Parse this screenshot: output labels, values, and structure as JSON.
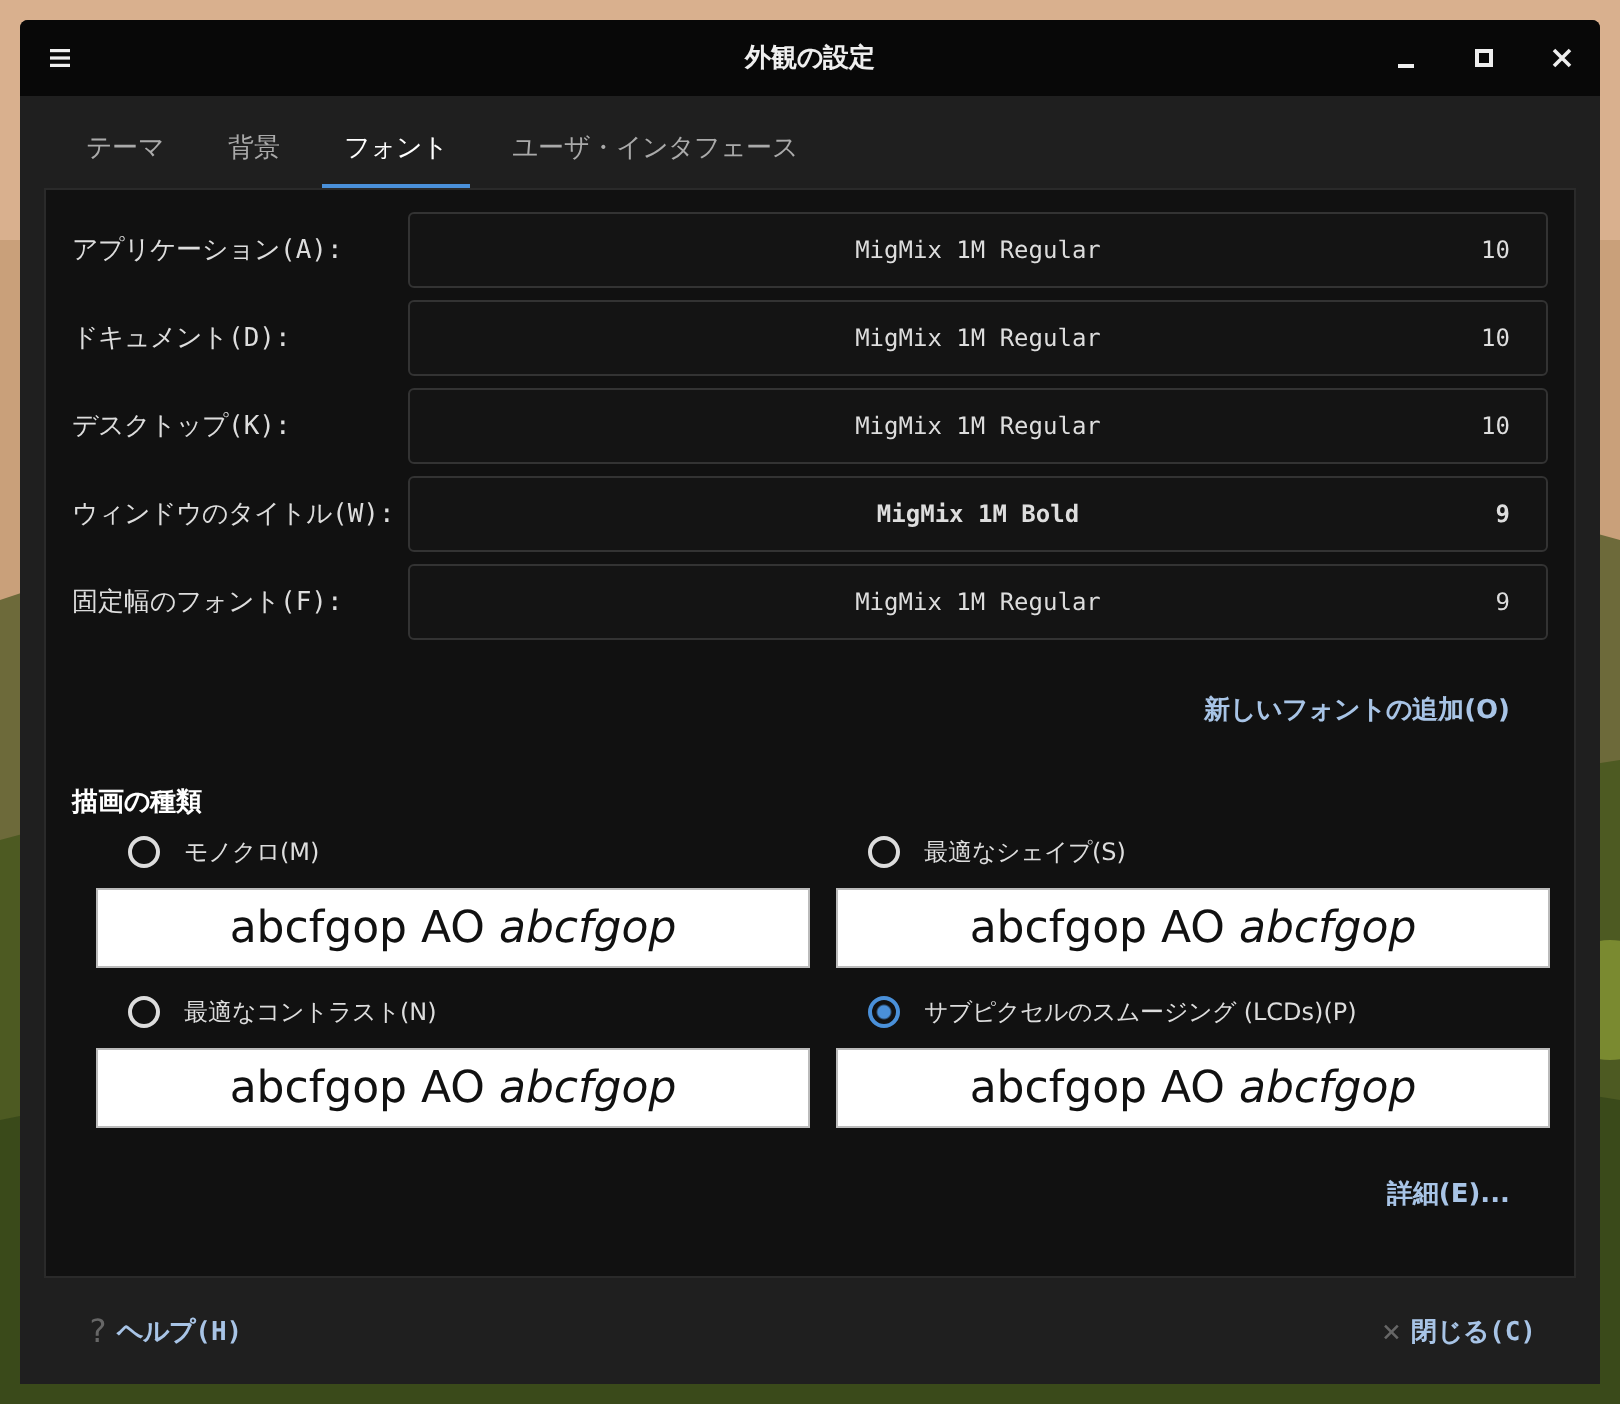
{
  "window": {
    "title": "外観の設定"
  },
  "tabs": [
    {
      "label": "テーマ",
      "selected": false
    },
    {
      "label": "背景",
      "selected": false
    },
    {
      "label": "フォント",
      "selected": true
    },
    {
      "label": "ユーザ・インタフェース",
      "selected": false
    }
  ],
  "fonts": [
    {
      "label": "アプリケーション(A):",
      "font": "MigMix 1M Regular",
      "size": "10",
      "bold": false
    },
    {
      "label": "ドキュメント(D):",
      "font": "MigMix 1M Regular",
      "size": "10",
      "bold": false
    },
    {
      "label": "デスクトップ(K):",
      "font": "MigMix 1M Regular",
      "size": "10",
      "bold": false
    },
    {
      "label": "ウィンドウのタイトル(W):",
      "font": "MigMix 1M Bold",
      "size": "9",
      "bold": true
    },
    {
      "label": "固定幅のフォント(F):",
      "font": "MigMix 1M Regular",
      "size": "9",
      "bold": false
    }
  ],
  "add_font_button": "新しいフォントの追加(O)",
  "rendering": {
    "heading": "描画の種類",
    "options": [
      {
        "label": "モノクロ(M)",
        "selected": false,
        "preview": "abcfgop AO *abcfgop*"
      },
      {
        "label": "最適なシェイプ(S)",
        "selected": false,
        "preview": "abcfgop AO *abcfgop*"
      },
      {
        "label": "最適なコントラスト(N)",
        "selected": false,
        "preview": "abcfgop AO *abcfgop*"
      },
      {
        "label": "サブピクセルのスムージング (LCDs)(P)",
        "selected": true,
        "preview": "abcfgop AO *abcfgop*"
      }
    ]
  },
  "details_button": "詳細(E)...",
  "footer": {
    "help": {
      "icon": "?",
      "label": "ヘルプ(H)"
    },
    "close": {
      "icon": "×",
      "label": "閉じる(C)"
    }
  }
}
